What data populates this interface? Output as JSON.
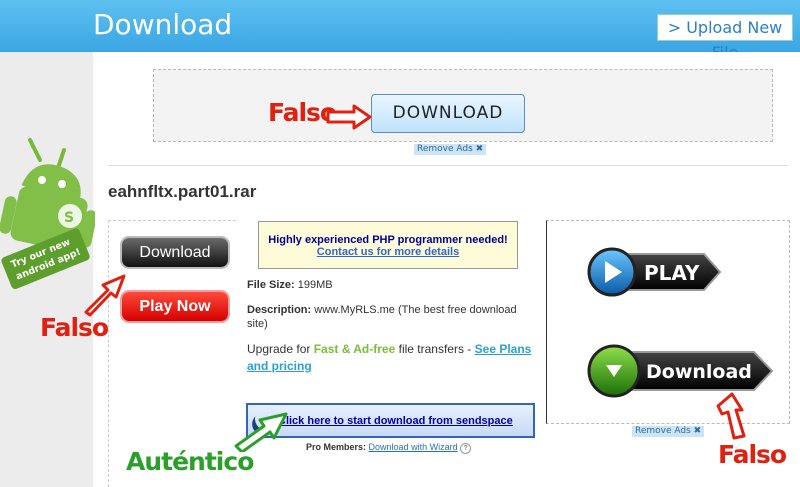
{
  "header": {
    "title": "Download",
    "upload_button": "> Upload New File"
  },
  "ads": {
    "top_fake_button": "DOWNLOAD",
    "remove_ads": "Remove Ads",
    "remove_ads_x": "✖"
  },
  "annotations": {
    "falso": "Falso",
    "autentico": "Auténtico"
  },
  "file": {
    "name": "eahnfltx.part01.rar",
    "size_label": "File Size:",
    "size_value": "199MB",
    "desc_label": "Description:",
    "desc_value": "www.MyRLS.me (The best free download site)",
    "upgrade_text": "Upgrade for ",
    "upgrade_emph": "Fast & Ad-free",
    "upgrade_rest": " file transfers - ",
    "plans_link": "See Plans and pricing"
  },
  "left_ad": {
    "download": "Download",
    "play_now": "Play Now"
  },
  "android_ad": {
    "text": "Try our new android app!"
  },
  "php_ad": {
    "line1": "Highly experienced PHP programmer needed!",
    "line2": "Contact us for more details"
  },
  "sendspace": {
    "label": "Click here to start download from sendspace"
  },
  "pro": {
    "label": "Pro Members:",
    "link": "Download with Wizard",
    "help": "?"
  },
  "right_ad": {
    "play": "PLAY",
    "download": "Download"
  },
  "colors": {
    "header_blue": "#3aa6e4",
    "falso_red": "#e02010",
    "autentico_green": "#2aa02a"
  }
}
